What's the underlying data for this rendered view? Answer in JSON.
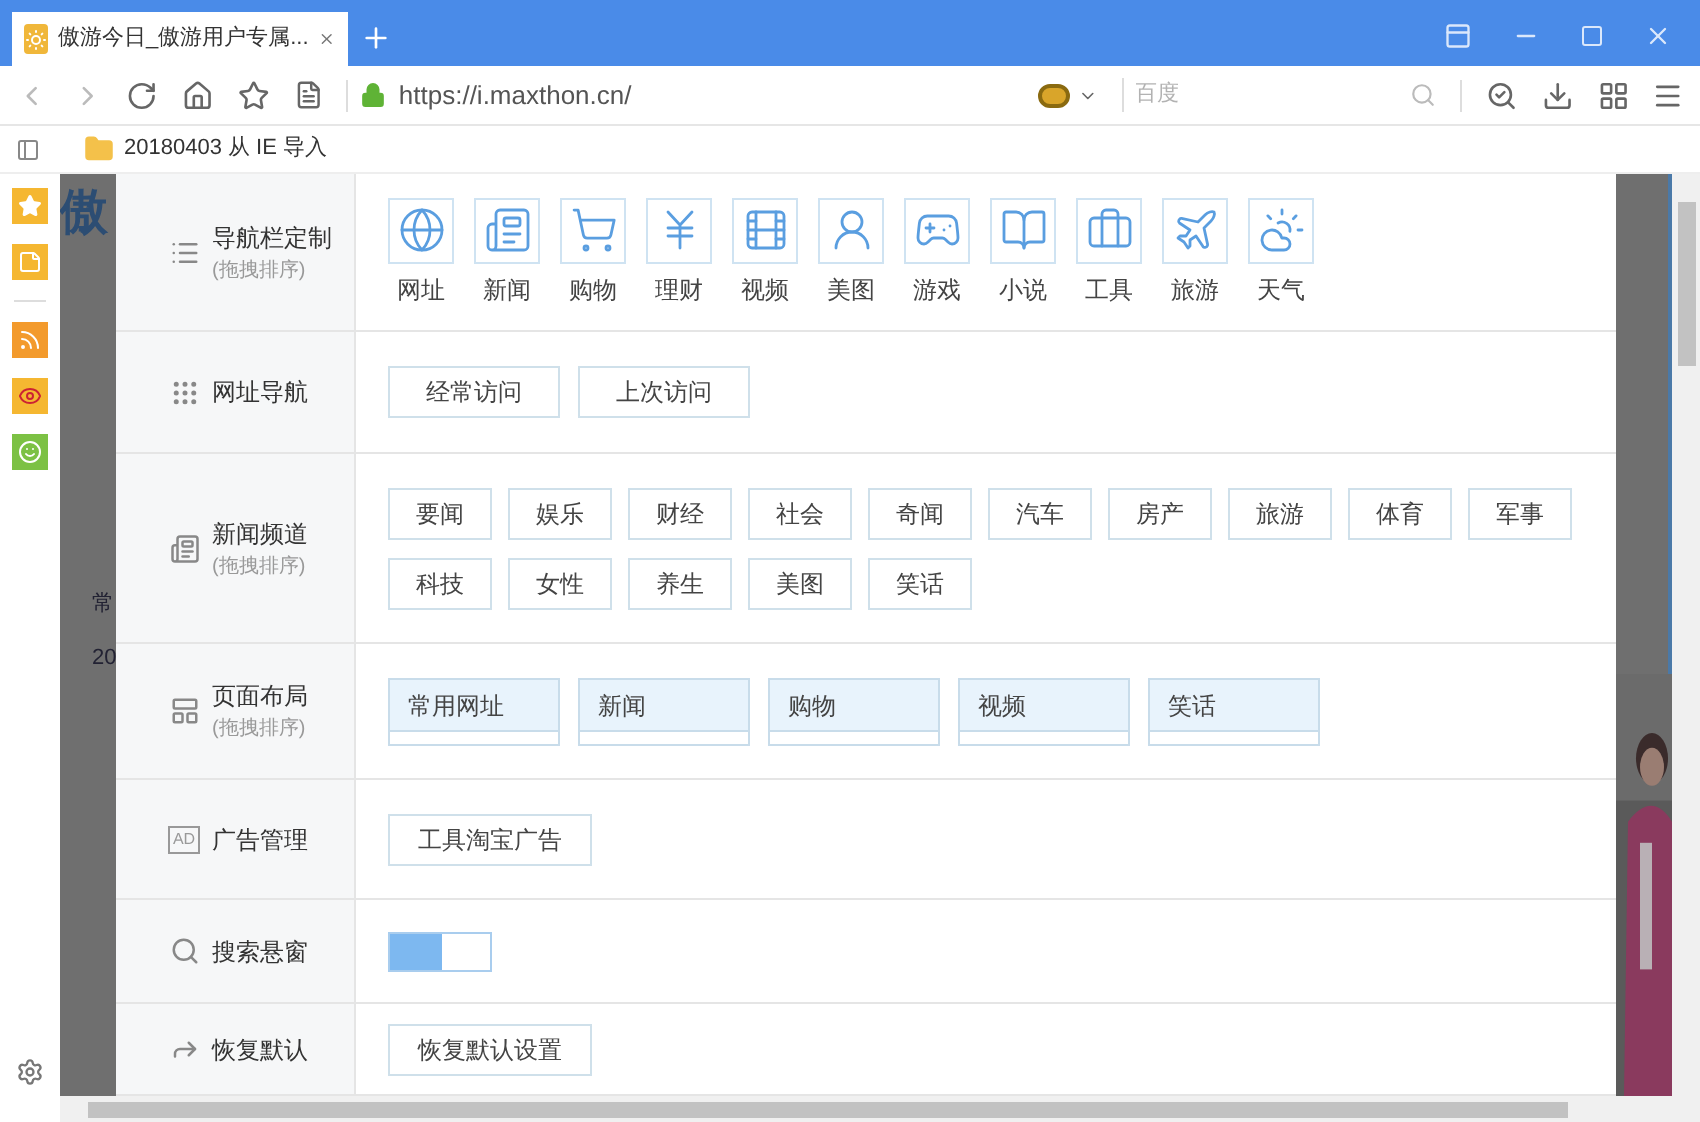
{
  "browser": {
    "tab": {
      "title": "傲游今日_傲游用户专属...",
      "selected": true
    },
    "url": "https://i.maxthon.cn/",
    "search_placeholder": "百度",
    "bookmarks": [
      {
        "label": "20180403 从 IE 导入"
      }
    ]
  },
  "background_page": {
    "logo": "傲",
    "texts": [
      "常",
      "20"
    ]
  },
  "settings": {
    "rows": [
      {
        "kind": "icons",
        "label": "导航栏定制",
        "hint": "(拖拽排序)",
        "items": [
          "网址",
          "新闻",
          "购物",
          "理财",
          "视频",
          "美图",
          "游戏",
          "小说",
          "工具",
          "旅游",
          "天气"
        ]
      },
      {
        "kind": "buttons",
        "label": "网址导航",
        "buttons": [
          "经常访问",
          "上次访问"
        ]
      },
      {
        "kind": "tags",
        "label": "新闻频道",
        "hint": "(拖拽排序)",
        "tags": [
          "要闻",
          "娱乐",
          "财经",
          "社会",
          "奇闻",
          "汽车",
          "房产",
          "旅游",
          "体育",
          "军事",
          "科技",
          "女性",
          "养生",
          "美图",
          "笑话"
        ]
      },
      {
        "kind": "layout",
        "label": "页面布局",
        "hint": "(拖拽排序)",
        "blocks": [
          "常用网址",
          "新闻",
          "购物",
          "视频",
          "笑话"
        ]
      },
      {
        "kind": "buttons",
        "label": "广告管理",
        "icon_text": "AD",
        "buttons": [
          "工具淘宝广告"
        ]
      },
      {
        "kind": "switch",
        "label": "搜索悬窗",
        "on": true
      },
      {
        "kind": "buttons",
        "label": "恢复默认",
        "buttons": [
          "恢复默认设置"
        ]
      }
    ]
  }
}
